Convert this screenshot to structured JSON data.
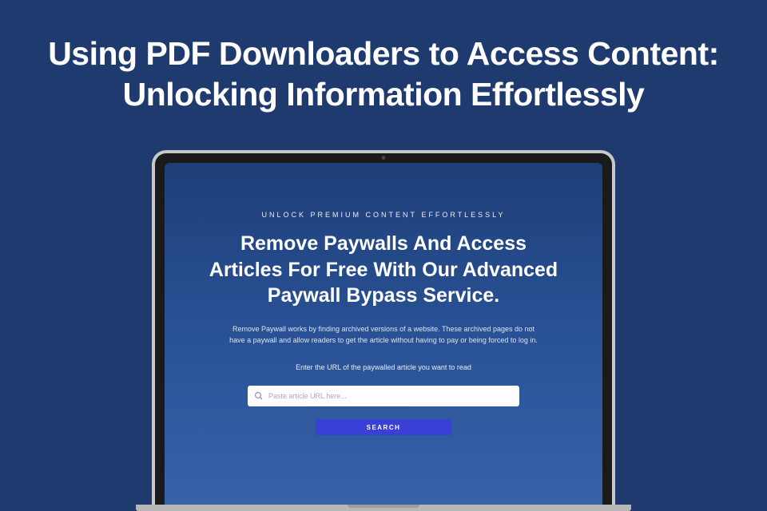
{
  "page": {
    "title_line1": "Using PDF Downloaders to Access Content:",
    "title_line2": "Unlocking Information Effortlessly"
  },
  "screen": {
    "eyebrow": "UNLOCK PREMIUM CONTENT EFFORTLESSLY",
    "hero_title": "Remove Paywalls And Access Articles For Free With Our Advanced Paywall Bypass Service.",
    "description": "Remove Paywall works by finding archived versions of a website. These archived pages do not have a paywall and allow readers to get the article without having to pay or being forced to log in.",
    "instruction": "Enter the URL of the paywalled article you want to read",
    "search_placeholder": "Paste article URL here...",
    "search_button": "SEARCH"
  }
}
